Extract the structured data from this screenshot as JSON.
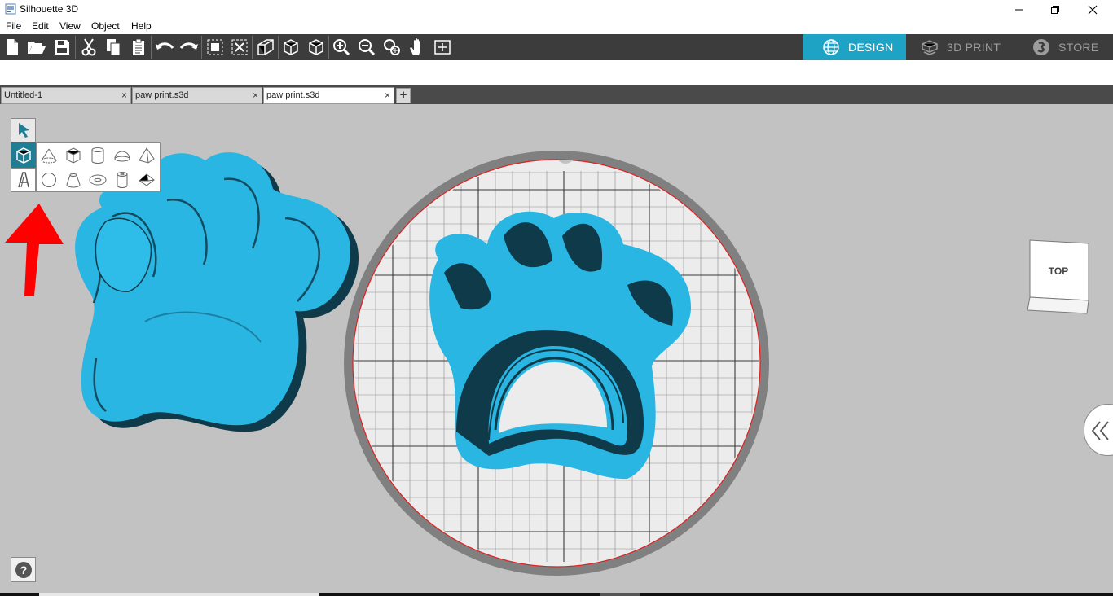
{
  "app": {
    "title": "Silhouette 3D"
  },
  "menu": [
    "File",
    "Edit",
    "View",
    "Object",
    "Help"
  ],
  "modes": {
    "design": "DESIGN",
    "print": "3D PRINT",
    "store": "STORE"
  },
  "tabs": [
    {
      "label": "Untitled-1",
      "close": "×"
    },
    {
      "label": "paw print.s3d",
      "close": "×"
    },
    {
      "label": "paw print.s3d",
      "close": "×"
    }
  ],
  "add_tab": "+",
  "view_cube": {
    "face": "TOP"
  },
  "help": "?",
  "colors": {
    "accent": "#1fa3c4",
    "paw": "#29b6e3",
    "paw_side": "#0f3a4a",
    "toolbar": "#3c3c3c",
    "canvas": "#c2c2c2",
    "bed_rim": "#808080",
    "arrow": "#ff0000"
  },
  "icons": [
    "new-file-icon",
    "open-folder-icon",
    "save-icon",
    "cut-icon",
    "copy-icon",
    "paste-icon",
    "undo-icon",
    "redo-icon",
    "group-icon",
    "ungroup-icon",
    "perspective-icon",
    "view-front-icon",
    "view-side-icon",
    "zoom-in-icon",
    "zoom-out-icon",
    "zoom-fit-icon",
    "pan-hand-icon",
    "fit-to-screen-icon"
  ]
}
